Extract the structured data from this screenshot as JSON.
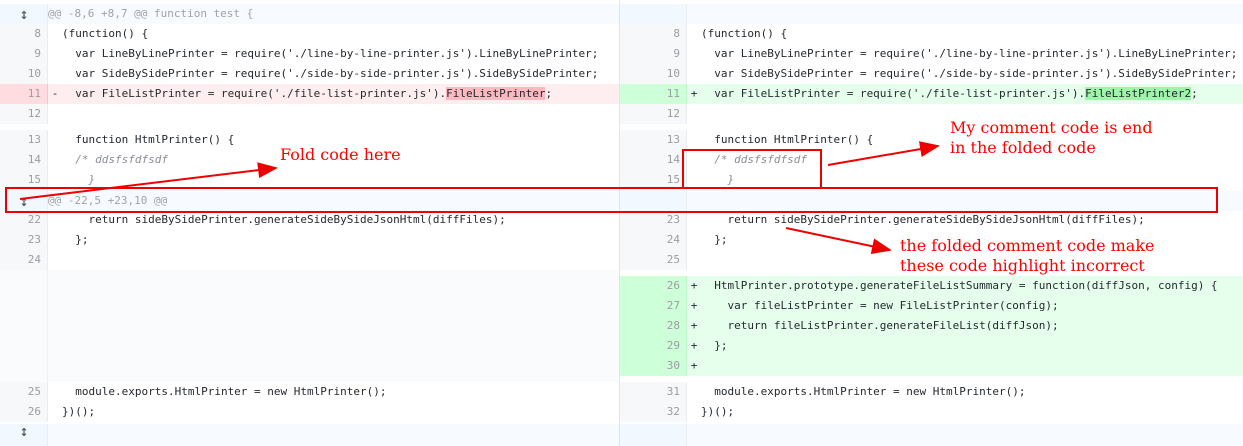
{
  "hunks": [
    {
      "header": "@@ -8,6 +8,7 @@ function test {"
    },
    {
      "header": "@@ -22,5 +23,10 @@"
    }
  ],
  "left_lines": [
    {
      "num": "8",
      "type": "ctx",
      "sign": "",
      "code": "(function() {"
    },
    {
      "num": "9",
      "type": "ctx",
      "sign": "",
      "code": "  var LineByLinePrinter = require('./line-by-line-printer.js').LineByLinePrinter;"
    },
    {
      "num": "10",
      "type": "ctx",
      "sign": "",
      "code": "  var SideBySidePrinter = require('./side-by-side-printer.js').SideBySidePrinter;"
    },
    {
      "num": "11",
      "type": "del",
      "sign": "-",
      "code_pre": "  var FileListPrinter = require('./file-list-printer.js').",
      "code_hl": "FileListPrinter",
      "code_post": ";"
    },
    {
      "num": "12",
      "type": "ctx",
      "sign": "",
      "code": ""
    },
    {
      "num": "13",
      "type": "ctx",
      "sign": "",
      "code": "  function HtmlPrinter() {"
    },
    {
      "num": "14",
      "type": "ctx",
      "sign": "",
      "code": "  /* ddsfsfdfsdf"
    },
    {
      "num": "15",
      "type": "ctx",
      "sign": "",
      "code": "    }"
    },
    {
      "num": "22",
      "type": "ctx",
      "sign": "",
      "code": "    return sideBySidePrinter.generateSideBySideJsonHtml(diffFiles);"
    },
    {
      "num": "23",
      "type": "ctx",
      "sign": "",
      "code": "  };"
    },
    {
      "num": "24",
      "type": "ctx",
      "sign": "",
      "code": ""
    },
    {
      "num": "25",
      "type": "ctx",
      "sign": "",
      "code": "  module.exports.HtmlPrinter = new HtmlPrinter();"
    },
    {
      "num": "26",
      "type": "ctx",
      "sign": "",
      "code": "})();"
    }
  ],
  "right_lines": [
    {
      "num": "8",
      "type": "ctx",
      "sign": "",
      "code": "(function() {"
    },
    {
      "num": "9",
      "type": "ctx",
      "sign": "",
      "code": "  var LineByLinePrinter = require('./line-by-line-printer.js').LineByLinePrinter;"
    },
    {
      "num": "10",
      "type": "ctx",
      "sign": "",
      "code": "  var SideBySidePrinter = require('./side-by-side-printer.js').SideBySidePrinter;"
    },
    {
      "num": "11",
      "type": "add",
      "sign": "+",
      "code_pre": "  var FileListPrinter = require('./file-list-printer.js').",
      "code_hl": "FileListPrinter2",
      "code_post": ";"
    },
    {
      "num": "12",
      "type": "ctx",
      "sign": "",
      "code": ""
    },
    {
      "num": "13",
      "type": "ctx",
      "sign": "",
      "code": "  function HtmlPrinter() {"
    },
    {
      "num": "14",
      "type": "ctx",
      "sign": "",
      "code": "  /* ddsfsfdfsdf"
    },
    {
      "num": "15",
      "type": "ctx",
      "sign": "",
      "code": "    }"
    },
    {
      "num": "23",
      "type": "ctx",
      "sign": "",
      "code": "    return sideBySidePrinter.generateSideBySideJsonHtml(diffFiles);"
    },
    {
      "num": "24",
      "type": "ctx",
      "sign": "",
      "code": "  };"
    },
    {
      "num": "25",
      "type": "ctx",
      "sign": "",
      "code": ""
    },
    {
      "num": "26",
      "type": "add",
      "sign": "+",
      "code": "  HtmlPrinter.prototype.generateFileListSummary = function(diffJson, config) {"
    },
    {
      "num": "27",
      "type": "add",
      "sign": "+",
      "code": "    var fileListPrinter = new FileListPrinter(config);"
    },
    {
      "num": "28",
      "type": "add",
      "sign": "+",
      "code": "    return fileListPrinter.generateFileList(diffJson);"
    },
    {
      "num": "29",
      "type": "add",
      "sign": "+",
      "code": "  };"
    },
    {
      "num": "30",
      "type": "add",
      "sign": "+",
      "code": ""
    },
    {
      "num": "31",
      "type": "ctx",
      "sign": "",
      "code": "  module.exports.HtmlPrinter = new HtmlPrinter();"
    },
    {
      "num": "32",
      "type": "ctx",
      "sign": "",
      "code": "})();"
    }
  ],
  "annotations": {
    "fold_code": "Fold code here",
    "comment_end": "My comment code is end\nin the folded code",
    "highlight_incorrect": "the folded comment code make\nthese code highlight incorrect"
  },
  "icons": {
    "expander": "unfold-icon"
  },
  "colors": {
    "annotation": "#ff0000",
    "deletion_bg": "#ffeef0",
    "addition_bg": "#e6ffed"
  }
}
